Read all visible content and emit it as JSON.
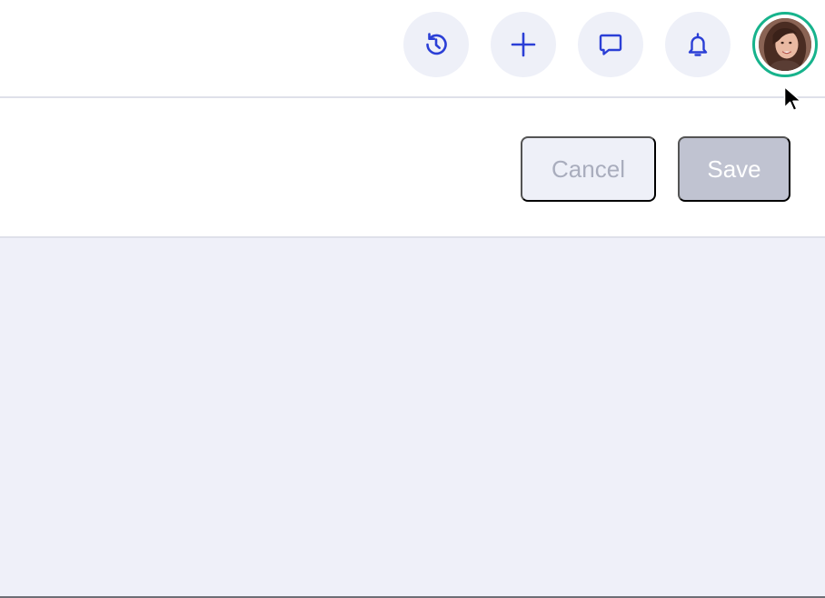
{
  "header": {
    "icons": {
      "history": "history-icon",
      "add": "plus-icon",
      "messages": "chat-bubble-icon",
      "notifications": "bell-icon"
    },
    "avatar": "user-avatar"
  },
  "actions": {
    "cancel_label": "Cancel",
    "save_label": "Save"
  },
  "colors": {
    "icon_accent": "#2b3fd6",
    "avatar_ring": "#17b38c",
    "icon_button_bg": "#eef0f8",
    "content_bg": "#eff0f9",
    "save_disabled_bg": "#c0c3d1",
    "cancel_disabled_text": "#a9adbd"
  }
}
